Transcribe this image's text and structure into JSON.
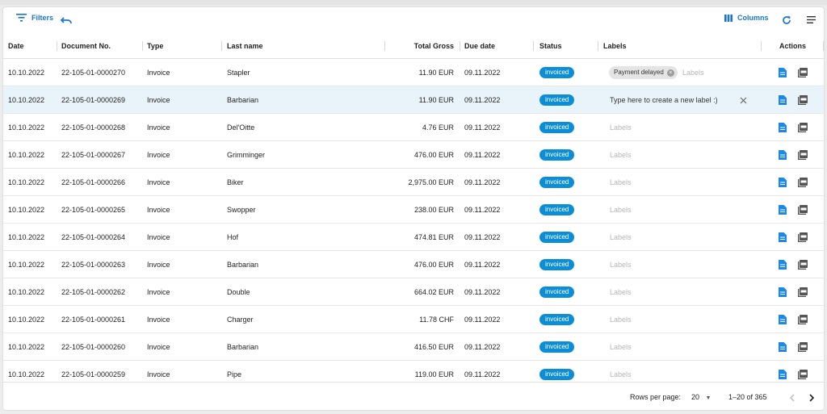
{
  "toolbar": {
    "filters_label": "Filters",
    "columns_label": "Columns"
  },
  "columns": {
    "date": "Date",
    "document_no": "Document No.",
    "type": "Type",
    "last_name": "Last name",
    "total_gross": "Total Gross",
    "due_date": "Due date",
    "status": "Status",
    "labels": "Labels",
    "actions": "Actions"
  },
  "rows": [
    {
      "date": "10.10.2022",
      "doc": "22-105-01-0000270",
      "type": "Invoice",
      "name": "Stapler",
      "total": "11.90 EUR",
      "due": "09.11.2022",
      "status": "invoiced",
      "label_chip": "Payment delayed",
      "labels_placeholder": "Labels"
    },
    {
      "date": "10.10.2022",
      "doc": "22-105-01-0000269",
      "type": "Invoice",
      "name": "Barbarian",
      "total": "11.90 EUR",
      "due": "09.11.2022",
      "status": "invoiced",
      "label_input": "Type here to create a new label :)"
    },
    {
      "date": "10.10.2022",
      "doc": "22-105-01-0000268",
      "type": "Invoice",
      "name": "Del'Oitte",
      "total": "4.76 EUR",
      "due": "09.11.2022",
      "status": "invoiced",
      "labels_placeholder": "Labels"
    },
    {
      "date": "10.10.2022",
      "doc": "22-105-01-0000267",
      "type": "Invoice",
      "name": "Grimminger",
      "total": "476.00 EUR",
      "due": "09.11.2022",
      "status": "invoiced",
      "labels_placeholder": "Labels"
    },
    {
      "date": "10.10.2022",
      "doc": "22-105-01-0000266",
      "type": "Invoice",
      "name": "Biker",
      "total": "2,975.00 EUR",
      "due": "09.11.2022",
      "status": "invoiced",
      "labels_placeholder": "Labels"
    },
    {
      "date": "10.10.2022",
      "doc": "22-105-01-0000265",
      "type": "Invoice",
      "name": "Swopper",
      "total": "238.00 EUR",
      "due": "09.11.2022",
      "status": "invoiced",
      "labels_placeholder": "Labels"
    },
    {
      "date": "10.10.2022",
      "doc": "22-105-01-0000264",
      "type": "Invoice",
      "name": "Hof",
      "total": "474.81 EUR",
      "due": "09.11.2022",
      "status": "invoiced",
      "labels_placeholder": "Labels"
    },
    {
      "date": "10.10.2022",
      "doc": "22-105-01-0000263",
      "type": "Invoice",
      "name": "Barbarian",
      "total": "476.00 EUR",
      "due": "09.11.2022",
      "status": "invoiced",
      "labels_placeholder": "Labels"
    },
    {
      "date": "10.10.2022",
      "doc": "22-105-01-0000262",
      "type": "Invoice",
      "name": "Double",
      "total": "664.02 EUR",
      "due": "09.11.2022",
      "status": "invoiced",
      "labels_placeholder": "Labels"
    },
    {
      "date": "10.10.2022",
      "doc": "22-105-01-0000261",
      "type": "Invoice",
      "name": "Charger",
      "total": "11.78 CHF",
      "due": "09.11.2022",
      "status": "invoiced",
      "labels_placeholder": "Labels"
    },
    {
      "date": "10.10.2022",
      "doc": "22-105-01-0000260",
      "type": "Invoice",
      "name": "Barbarian",
      "total": "416.50 EUR",
      "due": "09.11.2022",
      "status": "invoiced",
      "labels_placeholder": "Labels"
    },
    {
      "date": "10.10.2022",
      "doc": "22-105-01-0000259",
      "type": "Invoice",
      "name": "Pipe",
      "total": "119.00 EUR",
      "due": "09.11.2022",
      "status": "invoiced",
      "labels_placeholder": "Labels"
    }
  ],
  "footer": {
    "rows_per_page_label": "Rows per page:",
    "rows_per_page_value": "20",
    "range": "1–20 of 365"
  },
  "colors": {
    "accent": "#1976d2",
    "status_badge": "#0c8ed6",
    "selected_row": "#e9f4fa"
  },
  "icons": [
    "filter-icon",
    "undo-icon",
    "columns-icon",
    "refresh-icon",
    "density-icon",
    "document-icon",
    "pdf-icon",
    "chevron-left-icon",
    "chevron-right-icon",
    "dropdown-arrow-icon",
    "clear-icon"
  ]
}
